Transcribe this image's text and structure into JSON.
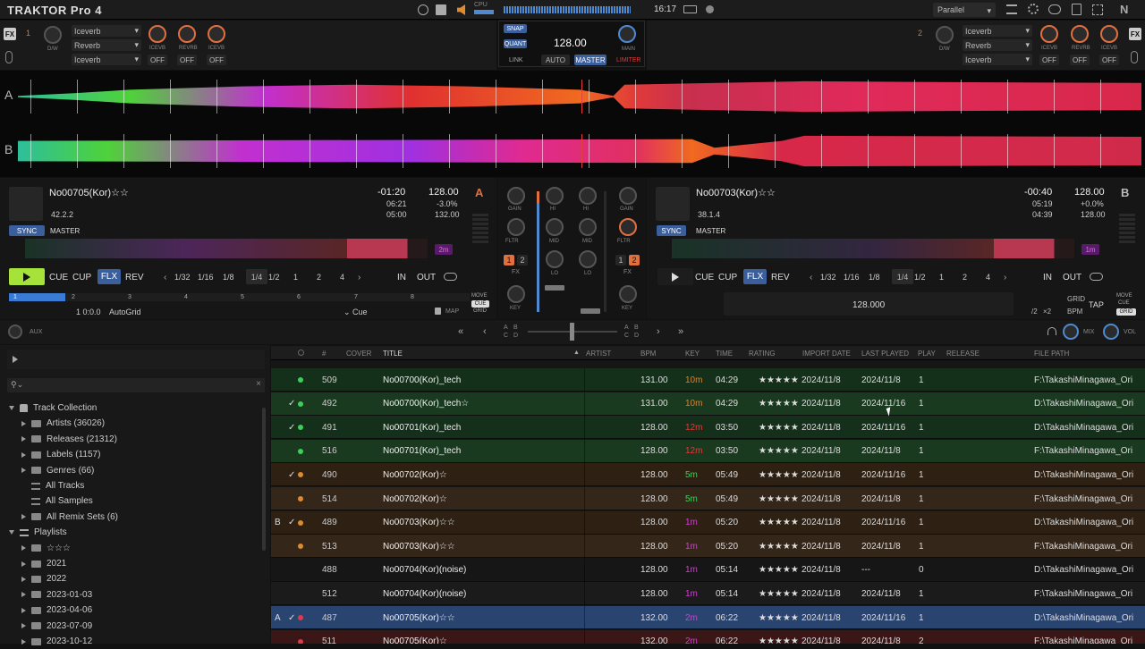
{
  "app": {
    "logo": "TRAKTOR Pro 4",
    "cpu_label": "CPU",
    "time": "16:17",
    "mixer_mode": "Parallel"
  },
  "fx_left": {
    "unit": "1",
    "fx_label": "FX",
    "dw_label": "D/W",
    "effects": [
      "Iceverb",
      "Reverb",
      "Iceverb"
    ],
    "knob_labels": [
      "ICEVB",
      "REVRB",
      "ICEVB"
    ],
    "buttons": [
      "OFF",
      "OFF",
      "OFF"
    ]
  },
  "fx_right": {
    "unit": "2",
    "dw_label": "D/W",
    "effects": [
      "Iceverb",
      "Reverb",
      "Iceverb"
    ],
    "knob_labels": [
      "ICEVB",
      "REVRB",
      "ICEVB"
    ],
    "buttons": [
      "OFF",
      "OFF",
      "OFF"
    ]
  },
  "master": {
    "snap": "SNAP",
    "quant": "QUANT",
    "bpm": "128.00",
    "main": "MAIN",
    "link": "LINK",
    "auto": "AUTO",
    "master": "MASTER",
    "limiter": "LIMITER"
  },
  "waveforms": {
    "a_label": "A",
    "b_label": "B"
  },
  "deckA": {
    "title": "No00705(Kor)☆☆",
    "key_value": "42.2.2",
    "remaining": "-01:20",
    "bpm": "128.00",
    "letter": "A",
    "elapsed": "06:21",
    "pitch": "-3.0%",
    "total": "05:00",
    "orig_bpm": "132.00",
    "sync": "SYNC",
    "master": "MASTER",
    "loop_len": "2m",
    "cue": "CUE",
    "cup": "CUP",
    "flx": "FLX",
    "rev": "REV",
    "loop_sizes": [
      "1/32",
      "1/16",
      "1/8",
      "1/4",
      "1/2",
      "1",
      "2",
      "4"
    ],
    "in": "IN",
    "out": "OUT",
    "move": "MOVE",
    "movecue": "CUE",
    "grid": "GRID",
    "beat_markers": [
      "1",
      "2",
      "3",
      "4",
      "5",
      "6",
      "7",
      "8"
    ],
    "position": "1 0:0.0",
    "autogrid": "AutoGrid",
    "cue_type": "Cue",
    "map": "MAP"
  },
  "deckB": {
    "title": "No00703(Kor)☆☆",
    "key_value": "38.1.4",
    "remaining": "-00:40",
    "bpm": "128.00",
    "letter": "B",
    "elapsed": "05:19",
    "pitch": "+0.0%",
    "total": "04:39",
    "orig_bpm": "128.00",
    "sync": "SYNC",
    "master": "MASTER",
    "loop_len": "1m",
    "cue": "CUE",
    "cup": "CUP",
    "flx": "FLX",
    "rev": "REV",
    "loop_sizes": [
      "1/32",
      "1/16",
      "1/8",
      "1/4",
      "1/2",
      "1",
      "2",
      "4"
    ],
    "in": "IN",
    "out": "OUT",
    "move": "MOVE",
    "movecue": "CUE",
    "grid": "GRID",
    "grid_bpm": "128.000",
    "grid_btn": "GRID",
    "bpm_btn": "BPM",
    "tap": "TAP",
    "half": "/2",
    "double": "×2"
  },
  "mixer": {
    "gain": "GAIN",
    "hi": "HI",
    "mid": "MID",
    "lo": "LO",
    "fltr": "FLTR",
    "fx": "FX",
    "key": "KEY",
    "ch1": "1",
    "ch2": "2"
  },
  "aux": {
    "aux": "AUX",
    "mix": "MIX",
    "vol": "VOL",
    "xf_left": [
      "A",
      "B",
      "C",
      "D"
    ],
    "xf_right": [
      "A",
      "B",
      "C",
      "D"
    ]
  },
  "browser": {
    "search_placeholder": "",
    "tree": [
      {
        "label": "Track Collection",
        "level": 0,
        "exp": "down",
        "icon": "collection"
      },
      {
        "label": "Artists (36026)",
        "level": 1,
        "exp": "right",
        "icon": "folder"
      },
      {
        "label": "Releases (21312)",
        "level": 1,
        "exp": "right",
        "icon": "folder"
      },
      {
        "label": "Labels (1157)",
        "level": 1,
        "exp": "right",
        "icon": "folder"
      },
      {
        "label": "Genres (66)",
        "level": 1,
        "exp": "right",
        "icon": "folder"
      },
      {
        "label": "All Tracks",
        "level": 1,
        "exp": "none",
        "icon": "list"
      },
      {
        "label": "All Samples",
        "level": 1,
        "exp": "none",
        "icon": "list"
      },
      {
        "label": "All Remix Sets (6)",
        "level": 1,
        "exp": "right",
        "icon": "folder"
      },
      {
        "label": "Playlists",
        "level": 0,
        "exp": "down",
        "icon": "playlist"
      },
      {
        "label": "☆☆☆",
        "level": 1,
        "exp": "right",
        "icon": "folder"
      },
      {
        "label": "2021",
        "level": 1,
        "exp": "right",
        "icon": "folder"
      },
      {
        "label": "2022",
        "level": 1,
        "exp": "right",
        "icon": "folder"
      },
      {
        "label": "2023-01-03",
        "level": 1,
        "exp": "right",
        "icon": "folder"
      },
      {
        "label": "2023-04-06",
        "level": 1,
        "exp": "right",
        "icon": "folder"
      },
      {
        "label": "2023-07-09",
        "level": 1,
        "exp": "right",
        "icon": "folder"
      },
      {
        "label": "2023-10-12",
        "level": 1,
        "exp": "right",
        "icon": "folder"
      }
    ],
    "columns": {
      "num": "#",
      "cover": "COVER",
      "title": "TITLE",
      "artist": "ARTIST",
      "bpm": "BPM",
      "key": "KEY",
      "time": "TIME",
      "rating": "RATING",
      "import": "IMPORT DATE",
      "last": "LAST PLAYED",
      "play": "PLAY",
      "release": "RELEASE",
      "path": "FILE PATH"
    },
    "rows": [
      {
        "deck": "",
        "check": "",
        "dot": "#3ccf5a",
        "num": "509",
        "title": "No00700(Kor)_tech",
        "bpm": "131.00",
        "key": "10m",
        "keycolor": "#e0802a",
        "time": "04:29",
        "rating": "★★★★★",
        "import": "2024/11/8",
        "last": "2024/11/8",
        "play": "1",
        "path": "F:\\TakashiMinagawa_Ori",
        "bg": "#15301a"
      },
      {
        "deck": "",
        "check": "✓",
        "dot": "#3ccf5a",
        "num": "492",
        "title": "No00700(Kor)_tech☆",
        "bpm": "131.00",
        "key": "10m",
        "keycolor": "#e0802a",
        "time": "04:29",
        "rating": "★★★★★",
        "import": "2024/11/8",
        "last": "2024/11/16",
        "play": "1",
        "path": "D:\\TakashiMinagawa_Ori",
        "bg": "#1a3a20"
      },
      {
        "deck": "",
        "check": "✓",
        "dot": "#3ccf5a",
        "num": "491",
        "title": "No00701(Kor)_tech",
        "bpm": "128.00",
        "key": "12m",
        "keycolor": "#e03a3a",
        "time": "03:50",
        "rating": "★★★★★",
        "import": "2024/11/8",
        "last": "2024/11/16",
        "play": "1",
        "path": "D:\\TakashiMinagawa_Ori",
        "bg": "#15301a"
      },
      {
        "deck": "",
        "check": "",
        "dot": "#3ccf5a",
        "num": "516",
        "title": "No00701(Kor)_tech",
        "bpm": "128.00",
        "key": "12m",
        "keycolor": "#e03a3a",
        "time": "03:50",
        "rating": "★★★★★",
        "import": "2024/11/8",
        "last": "2024/11/8",
        "play": "1",
        "path": "F:\\TakashiMinagawa_Ori",
        "bg": "#1a3a20"
      },
      {
        "deck": "",
        "check": "✓",
        "dot": "#e08a30",
        "num": "490",
        "title": "No00702(Kor)☆",
        "bpm": "128.00",
        "key": "5m",
        "keycolor": "#3ccf5a",
        "time": "05:49",
        "rating": "★★★★★",
        "import": "2024/11/8",
        "last": "2024/11/16",
        "play": "1",
        "path": "D:\\TakashiMinagawa_Ori",
        "bg": "#2e2113"
      },
      {
        "deck": "",
        "check": "",
        "dot": "#e08a30",
        "num": "514",
        "title": "No00702(Kor)☆",
        "bpm": "128.00",
        "key": "5m",
        "keycolor": "#3ccf5a",
        "time": "05:49",
        "rating": "★★★★★",
        "import": "2024/11/8",
        "last": "2024/11/8",
        "play": "1",
        "path": "F:\\TakashiMinagawa_Ori",
        "bg": "#35261a"
      },
      {
        "deck": "B",
        "check": "✓",
        "dot": "#e08a30",
        "num": "489",
        "title": "No00703(Kor)☆☆",
        "bpm": "128.00",
        "key": "1m",
        "keycolor": "#d040d0",
        "time": "05:20",
        "rating": "★★★★★",
        "import": "2024/11/8",
        "last": "2024/11/16",
        "play": "1",
        "path": "D:\\TakashiMinagawa_Ori",
        "bg": "#2e2113"
      },
      {
        "deck": "",
        "check": "",
        "dot": "#e08a30",
        "num": "513",
        "title": "No00703(Kor)☆☆",
        "bpm": "128.00",
        "key": "1m",
        "keycolor": "#d040d0",
        "time": "05:20",
        "rating": "★★★★★",
        "import": "2024/11/8",
        "last": "2024/11/8",
        "play": "1",
        "path": "F:\\TakashiMinagawa_Ori",
        "bg": "#35261a"
      },
      {
        "deck": "",
        "check": "",
        "dot": "",
        "num": "488",
        "title": "No00704(Kor)(noise)",
        "bpm": "128.00",
        "key": "1m",
        "keycolor": "#d040d0",
        "time": "05:14",
        "rating": "★★★★★",
        "import": "2024/11/8",
        "last": "---",
        "play": "0",
        "path": "D:\\TakashiMinagawa_Ori",
        "bg": "#161616"
      },
      {
        "deck": "",
        "check": "",
        "dot": "",
        "num": "512",
        "title": "No00704(Kor)(noise)",
        "bpm": "128.00",
        "key": "1m",
        "keycolor": "#d040d0",
        "time": "05:14",
        "rating": "★★★★★",
        "import": "2024/11/8",
        "last": "2024/11/8",
        "play": "1",
        "path": "F:\\TakashiMinagawa_Ori",
        "bg": "#1b1b1b"
      },
      {
        "deck": "A",
        "check": "✓",
        "dot": "#e03a4a",
        "num": "487",
        "title": "No00705(Kor)☆☆",
        "bpm": "132.00",
        "key": "2m",
        "keycolor": "#d040d0",
        "time": "06:22",
        "rating": "★★★★★",
        "import": "2024/11/8",
        "last": "2024/11/16",
        "play": "1",
        "path": "D:\\TakashiMinagawa_Ori",
        "bg": "#2a4470"
      },
      {
        "deck": "",
        "check": "",
        "dot": "#e03a4a",
        "num": "511",
        "title": "No00705(Kor)☆",
        "bpm": "132.00",
        "key": "2m",
        "keycolor": "#d040d0",
        "time": "06:22",
        "rating": "★★★★★",
        "import": "2024/11/8",
        "last": "2024/11/8",
        "play": "2",
        "path": "F:\\TakashiMinagawa_Ori",
        "bg": "#3a1616"
      }
    ]
  },
  "colors": {
    "accent": "#3a7bd5",
    "play_green": "#a6e33a",
    "deckA_wave": "#e8304a",
    "deckB_wave": "#e0304a"
  }
}
